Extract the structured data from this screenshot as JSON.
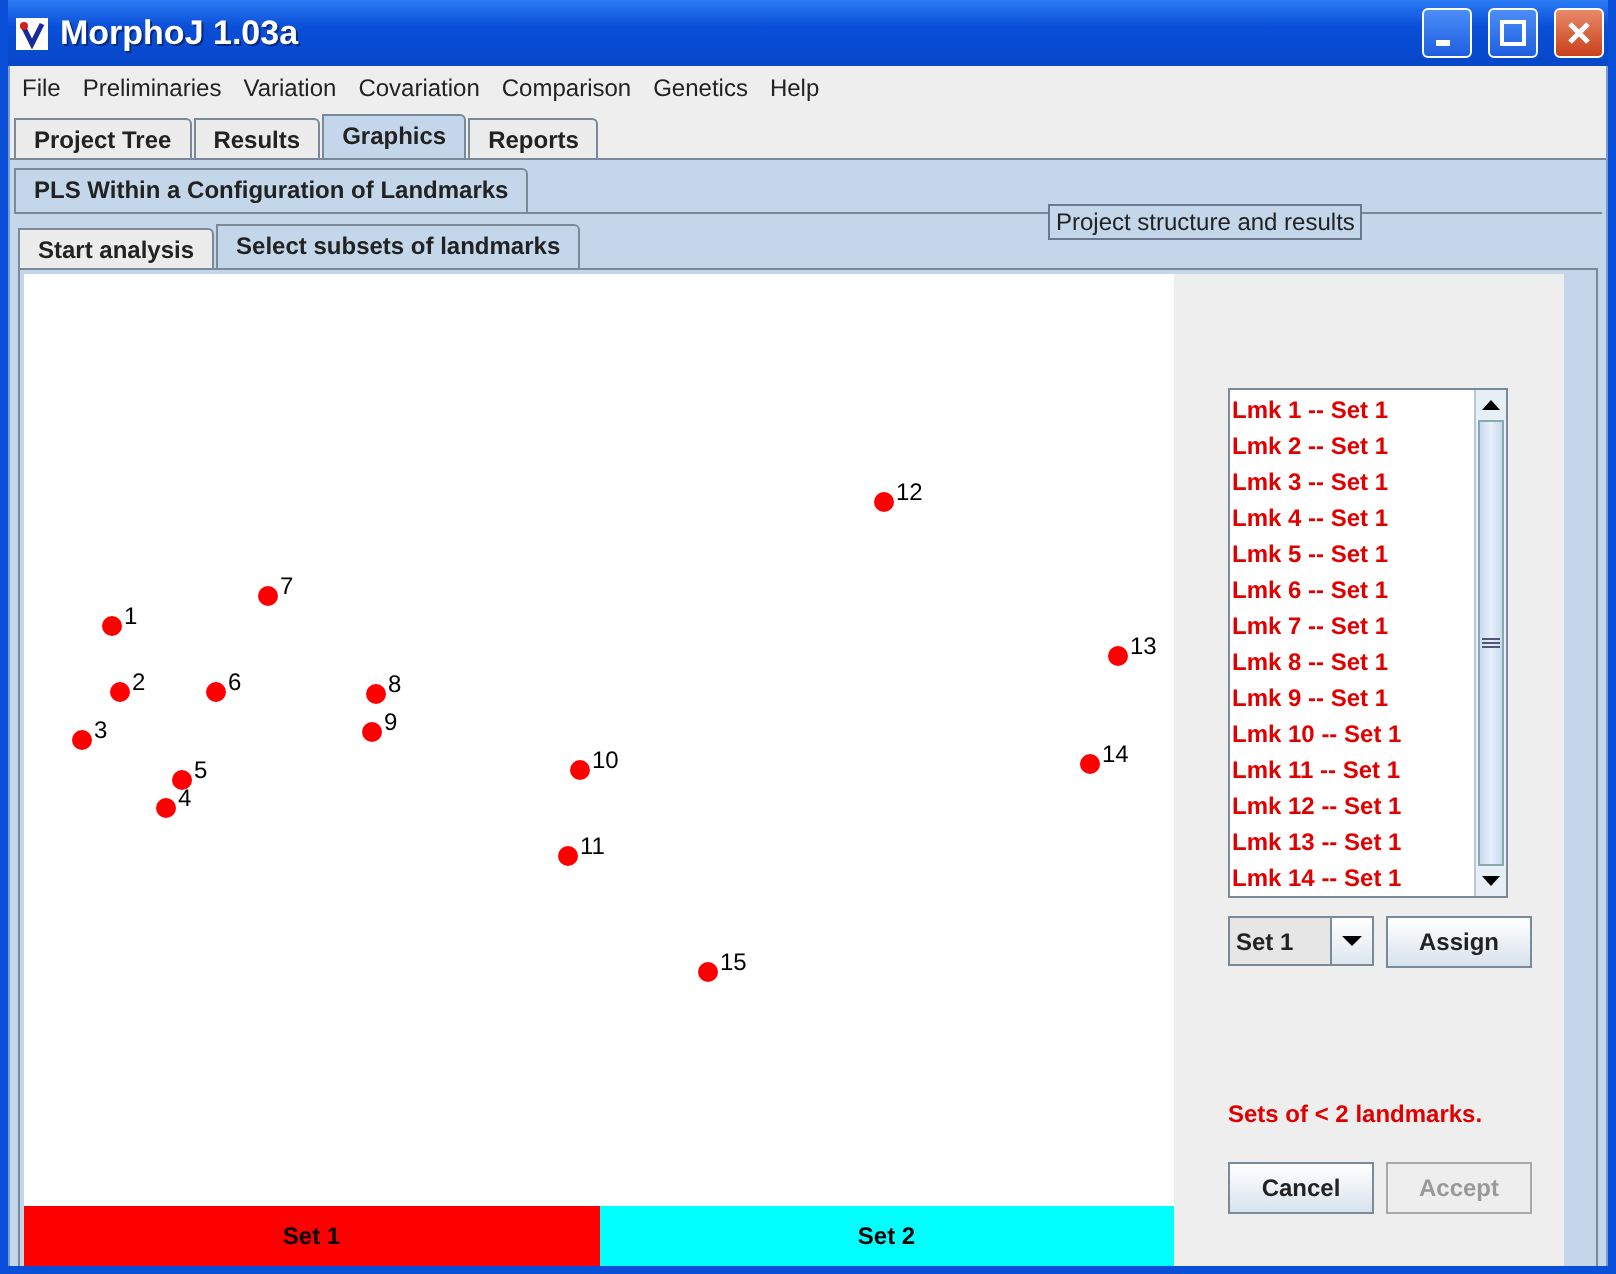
{
  "window": {
    "title": "MorphoJ 1.03a"
  },
  "menu": [
    "File",
    "Preliminaries",
    "Variation",
    "Covariation",
    "Comparison",
    "Genetics",
    "Help"
  ],
  "tabs": [
    {
      "label": "Project Tree",
      "selected": false
    },
    {
      "label": "Results",
      "selected": false
    },
    {
      "label": "Graphics",
      "selected": true
    },
    {
      "label": "Reports",
      "selected": false
    }
  ],
  "analysis_tabs": [
    {
      "label": "PLS Within a Configuration of Landmarks",
      "selected": true
    }
  ],
  "sub_tabs": [
    {
      "label": "Start analysis",
      "selected": false
    },
    {
      "label": "Select subsets of landmarks",
      "selected": true
    }
  ],
  "tooltip": "Project structure and results",
  "landmarks": [
    {
      "label": "1",
      "color": "#ff0000"
    },
    {
      "label": "2",
      "color": "#ff0000"
    },
    {
      "label": "3",
      "color": "#ff0000"
    },
    {
      "label": "4",
      "color": "#ff0000"
    },
    {
      "label": "5",
      "color": "#ff0000"
    },
    {
      "label": "6",
      "color": "#ff0000"
    },
    {
      "label": "7",
      "color": "#ff0000"
    },
    {
      "label": "8",
      "color": "#ff0000"
    },
    {
      "label": "9",
      "color": "#ff0000"
    },
    {
      "label": "10",
      "color": "#ff0000"
    },
    {
      "label": "11",
      "color": "#ff0000"
    },
    {
      "label": "12",
      "color": "#ff0000"
    },
    {
      "label": "13",
      "color": "#ff0000"
    },
    {
      "label": "14",
      "color": "#ff0000"
    },
    {
      "label": "15",
      "color": "#ff0000"
    }
  ],
  "landmark_list": [
    "Lmk 1 -- Set 1",
    "Lmk 2 -- Set 1",
    "Lmk 3 -- Set 1",
    "Lmk 4 -- Set 1",
    "Lmk 5 -- Set 1",
    "Lmk 6 -- Set 1",
    "Lmk 7 -- Set 1",
    "Lmk 8 -- Set 1",
    "Lmk 9 -- Set 1",
    "Lmk 10 -- Set 1",
    "Lmk 11 -- Set 1",
    "Lmk 12 -- Set 1",
    "Lmk 13 -- Set 1",
    "Lmk 14 -- Set 1"
  ],
  "set_selector": {
    "value": "Set 1"
  },
  "assign_button": "Assign",
  "message": "Sets of < 2 landmarks.",
  "buttons": [
    {
      "label": "Cancel",
      "disabled": false
    },
    {
      "label": "Accept",
      "disabled": true
    }
  ],
  "sets": [
    {
      "label": "Set 1",
      "color": "#ff0000"
    },
    {
      "label": "Set 2",
      "color": "#00ffff"
    }
  ]
}
